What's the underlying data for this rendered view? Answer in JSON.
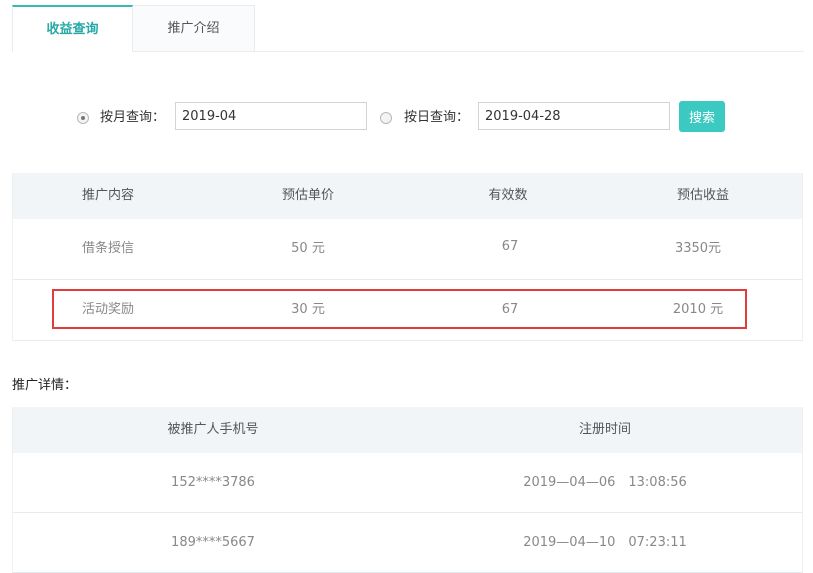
{
  "tabs": [
    {
      "label": "收益查询",
      "active": true
    },
    {
      "label": "推广介绍",
      "active": false
    }
  ],
  "filters": {
    "by_month_label": "按月查询：",
    "by_month_value": "2019-04",
    "by_month_selected": true,
    "by_day_label": "按日查询：",
    "by_day_value": "2019-04-28",
    "by_day_selected": false,
    "search_label": "搜索"
  },
  "earnings_table": {
    "headers": [
      "推广内容",
      "预估单价",
      "有效数",
      "预估收益"
    ],
    "rows": [
      {
        "content": "借条授信",
        "unit_price": "50 元",
        "count": "67",
        "income": "3350元"
      },
      {
        "content": "活动奖励",
        "unit_price": "30 元",
        "count": "67",
        "income": "2010 元"
      }
    ]
  },
  "details": {
    "title": "推广详情：",
    "headers": [
      "被推广人手机号",
      "注册时间"
    ],
    "rows": [
      {
        "phone": "152****3786",
        "time": "2019—04—06　13:08:56"
      },
      {
        "phone": "189****5667",
        "time": "2019—04—10　07:23:11"
      }
    ]
  },
  "colors": {
    "accent": "#3ab7b1",
    "button": "#3cc9c1",
    "highlight": "#e23b3b",
    "header_bg": "#f2f5f8"
  }
}
